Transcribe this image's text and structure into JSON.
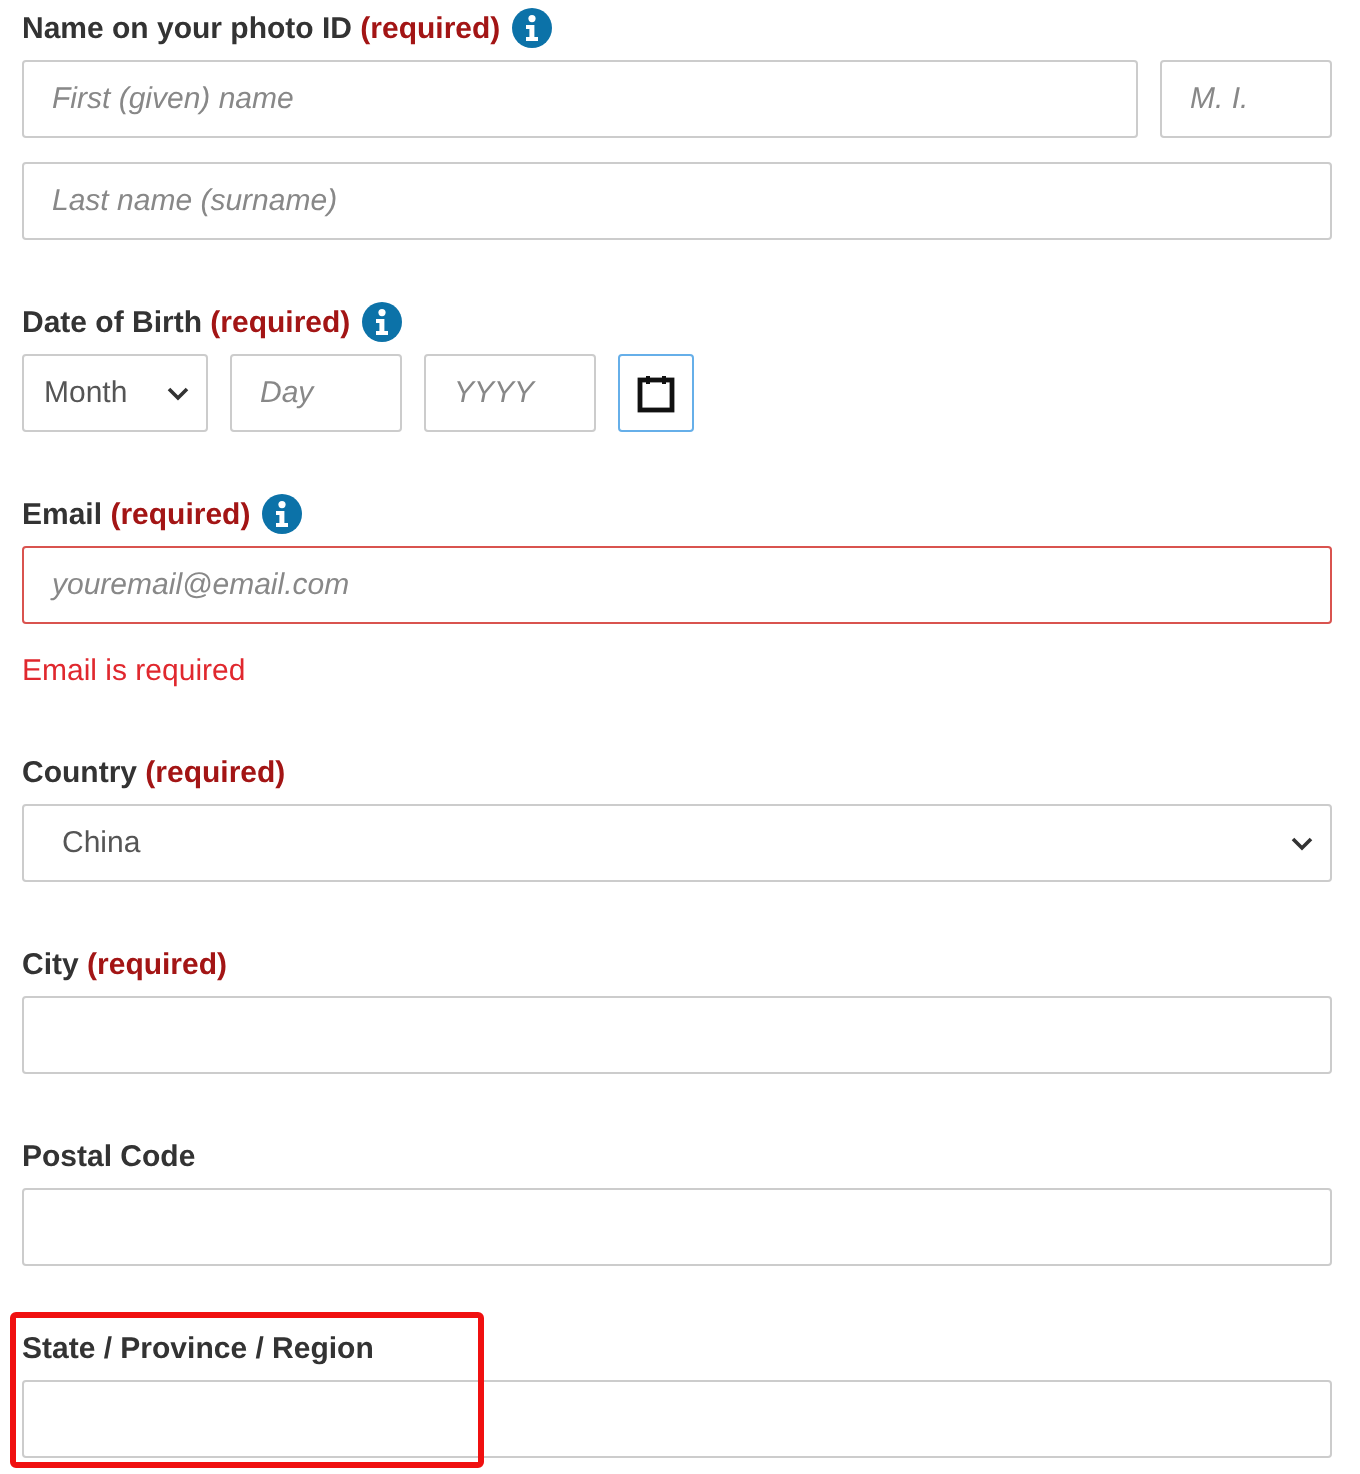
{
  "sections": [
    {
      "label": "Name on your photo ID",
      "required": "(required)",
      "info": true,
      "highlighted": false,
      "rows": [
        [
          {
            "kind": "text",
            "placeholder": "First (given) name",
            "grow": true
          },
          {
            "kind": "text",
            "placeholder": "M. I.",
            "grow": false
          }
        ],
        [
          {
            "kind": "text",
            "placeholder": "Last name (surname)",
            "grow": true
          }
        ]
      ]
    },
    {
      "label": "Date of Birth",
      "required": "(required)",
      "info": true,
      "highlighted": false,
      "rows": [
        [
          {
            "kind": "select",
            "value": "Month",
            "grow": false
          },
          {
            "kind": "text",
            "placeholder": "Day",
            "grow": false
          },
          {
            "kind": "text",
            "placeholder": "YYYY",
            "grow": false
          },
          {
            "kind": "calendar"
          }
        ]
      ]
    },
    {
      "label": "Email",
      "required": "(required)",
      "info": true,
      "highlighted": false,
      "error": "Email is required",
      "rows": [
        [
          {
            "kind": "text",
            "placeholder": "youremail@email.com",
            "grow": true,
            "invalid": true
          }
        ]
      ]
    },
    {
      "label": "Country",
      "required": "(required)",
      "info": false,
      "highlighted": false,
      "rows": [
        [
          {
            "kind": "select",
            "value": "China",
            "grow": true
          }
        ]
      ]
    },
    {
      "label": "City",
      "required": "(required)",
      "info": false,
      "highlighted": false,
      "rows": [
        [
          {
            "kind": "text",
            "grow": true
          }
        ]
      ]
    },
    {
      "label": "Postal Code",
      "info": false,
      "highlighted": false,
      "rows": [
        [
          {
            "kind": "text",
            "grow": true
          }
        ]
      ]
    },
    {
      "label": "State / Province / Region",
      "info": false,
      "highlighted": true,
      "rows": [
        [
          {
            "kind": "text",
            "grow": true
          }
        ]
      ]
    }
  ]
}
